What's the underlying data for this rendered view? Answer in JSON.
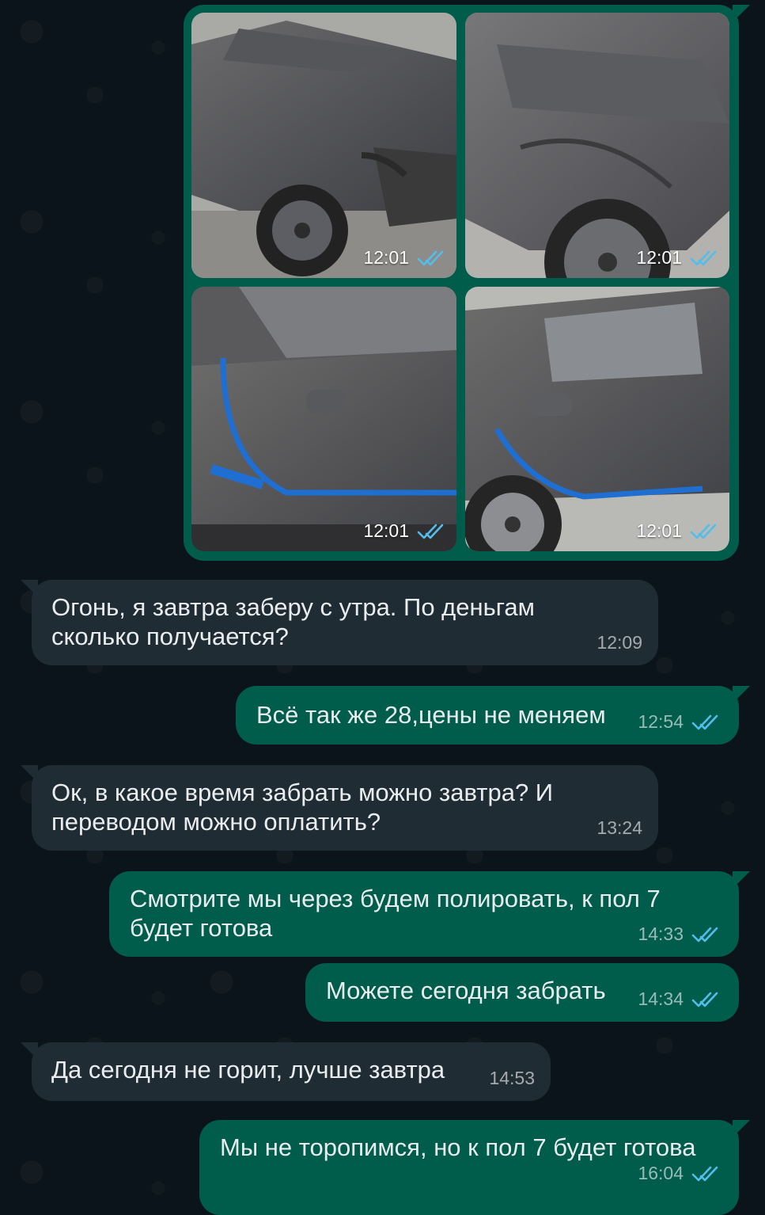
{
  "colors": {
    "background": "#0b141a",
    "outgoing_bubble": "#005c4b",
    "incoming_bubble": "#202c33",
    "read_ticks": "#53bdeb"
  },
  "album": {
    "photos": [
      {
        "time": "12:01",
        "status": "read-ticks-icon"
      },
      {
        "time": "12:01",
        "status": "read-ticks-icon"
      },
      {
        "time": "12:01",
        "status": "read-ticks-icon"
      },
      {
        "time": "12:01",
        "status": "read-ticks-icon"
      }
    ]
  },
  "messages": [
    {
      "direction": "in",
      "text": "Огонь, я завтра заберу с утра. По деньгам\nсколько получается?",
      "time": "12:09"
    },
    {
      "direction": "out",
      "text": "Всё так же 28,цены не меняем",
      "time": "12:54",
      "status": "read-ticks-icon"
    },
    {
      "direction": "in",
      "text": "Ок, в какое время забрать можно завтра? И\nпереводом можно оплатить?",
      "time": "13:24"
    },
    {
      "direction": "out",
      "text": "Смотрите мы через будем полировать, к пол 7\nбудет готова",
      "time": "14:33",
      "status": "read-ticks-icon"
    },
    {
      "direction": "out",
      "text": "Можете сегодня забрать",
      "time": "14:34",
      "status": "read-ticks-icon"
    },
    {
      "direction": "in",
      "text": "Да сегодня не горит, лучше завтра",
      "time": "14:53"
    },
    {
      "direction": "out",
      "text": "Мы не торопимся, но к пол 7 будет готова",
      "time": "16:04",
      "status": "read-ticks-icon"
    }
  ]
}
